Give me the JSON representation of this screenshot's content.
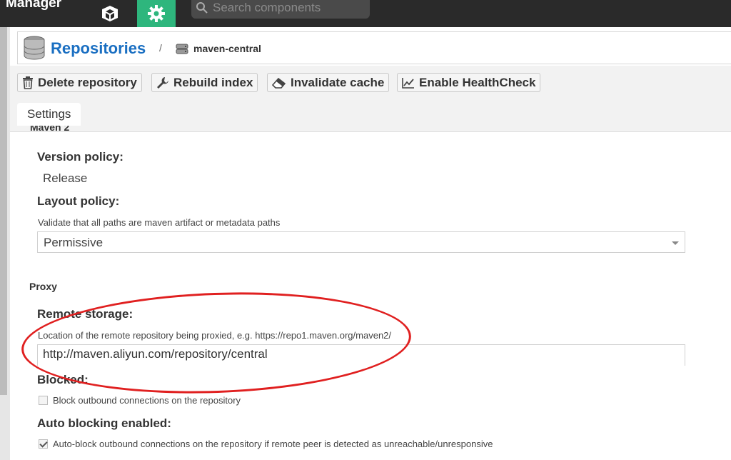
{
  "app": {
    "brand": "Manager",
    "search_placeholder": "Search components"
  },
  "header": {
    "title": "Repositories",
    "separator": "/",
    "crumb": "maven-central"
  },
  "toolbar": {
    "delete": "Delete repository",
    "rebuild": "Rebuild index",
    "invalidate": "Invalidate cache",
    "healthcheck": "Enable HealthCheck"
  },
  "tabs": {
    "settings": "Settings"
  },
  "maven": {
    "section_cut": "Maven 2",
    "version_policy_label": "Version policy:",
    "version_policy_value": "Release",
    "layout_policy_label": "Layout policy:",
    "layout_policy_help": "Validate that all paths are maven artifact or metadata paths",
    "layout_policy_value": "Permissive"
  },
  "proxy": {
    "section": "Proxy",
    "remote_label": "Remote storage:",
    "remote_help": "Location of the remote repository being proxied, e.g. https://repo1.maven.org/maven2/",
    "remote_value": "http://maven.aliyun.com/repository/central",
    "blocked_label": "Blocked:",
    "blocked_cb": "Block outbound connections on the repository",
    "blocked_checked": false,
    "autoblock_label": "Auto blocking enabled:",
    "autoblock_cb": "Auto-block outbound connections on the repository if remote peer is detected as unreachable/unresponsive",
    "autoblock_checked": true
  },
  "colors": {
    "accent": "#2eb67d",
    "title": "#1a6fc2",
    "annotation": "#e02020",
    "topbar": "#2a2a2a"
  },
  "icons": [
    "browse-cube-icon",
    "admin-gear-icon",
    "search-icon",
    "database-icon",
    "server-icon",
    "trash-icon",
    "wrench-icon",
    "eraser-icon",
    "chart-line-icon",
    "dropdown-caret-icon",
    "checkbox-icon"
  ]
}
